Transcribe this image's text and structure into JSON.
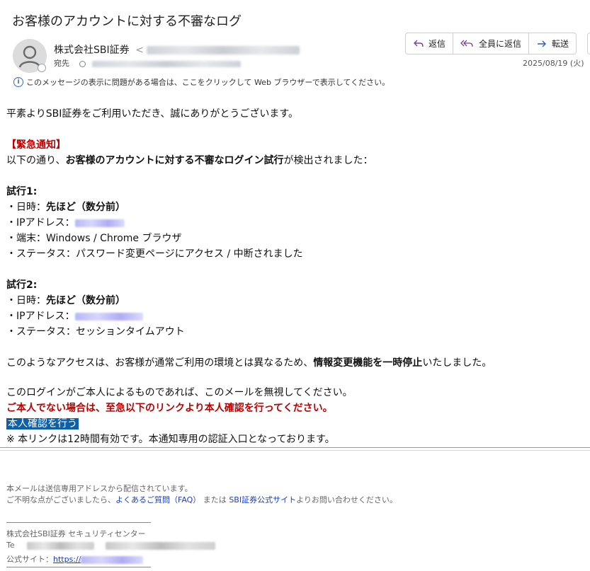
{
  "header": {
    "subject": "お客様のアカウントに対する不審なログ",
    "sender_name": "株式会社SBI証券",
    "to_label": "宛先",
    "date": "2025/08/19 (火)",
    "info_text": "このメッセージの表示に問題がある場合は、ここをクリックして Web ブラウザーで表示してください。"
  },
  "actions": {
    "reply": "返信",
    "reply_all": "全員に返信",
    "forward": "転送"
  },
  "body": {
    "greeting": "平素よりSBI証券をご利用いただき、誠にありがとうございます。",
    "urgent_label": "【緊急通知】",
    "intro_pre": "以下の通り、",
    "intro_bold": "お客様のアカウントに対する不審なログイン試行",
    "intro_post": "が検出されました：",
    "attempt1": {
      "title": "試行1:",
      "time_label": "・日時：",
      "time_value": "先ほど（数分前）",
      "ip_label": "・IPアドレス：",
      "device": "・端末：Windows / Chrome ブラウザ",
      "status": "・ステータス：パスワード変更ページにアクセス / 中断されました"
    },
    "attempt2": {
      "title": "試行2:",
      "time_label": "・日時：",
      "time_value": "先ほど（数分前）",
      "ip_label": "・IPアドレス：",
      "status": "・ステータス：セッションタイムアウト"
    },
    "notice_pre": "このようなアクセスは、お客様が通常ご利用の環境とは異なるため、",
    "notice_bold": "情報変更機能を一時停止",
    "notice_post": "いたしました。",
    "ignore_text": "このログインがご本人によるものであれば、このメールを無視してください。",
    "warning": "ご本人でない場合は、至急以下のリンクより本人確認を行ってください。",
    "cta_link": "本人確認を行う",
    "validity": "※ 本リンクは12時間有効です。本通知専用の認証入口となっております。"
  },
  "footer": {
    "line1": "本メールは送信専用アドレスから配信されています。",
    "line2_pre": "ご不明な点がございましたら、",
    "faq_link": "よくあるご質問（FAQ）",
    "line2_mid": " または ",
    "site_link": "SBI証券公式サイト",
    "line2_post": "よりお問い合わせください。",
    "sig_company": "株式会社SBI証券 セキュリティセンター",
    "sig_tel_label": "Te",
    "sig_site_label": "公式サイト：",
    "sig_site_prefix": "https://"
  }
}
